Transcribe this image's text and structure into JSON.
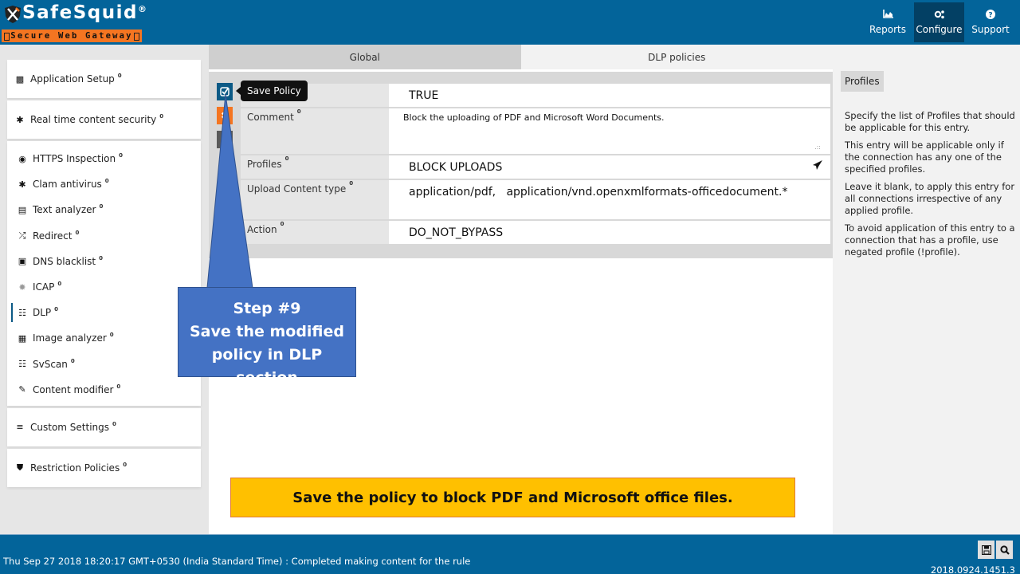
{
  "header": {
    "logo_title": "SafeSquid",
    "logo_reg": "®",
    "logo_subtitle": "Secure Web Gateway",
    "nav": [
      {
        "label": "Reports",
        "icon": "area-chart-icon",
        "active": false
      },
      {
        "label": "Configure",
        "icon": "cogs-icon",
        "active": true
      },
      {
        "label": "Support",
        "icon": "question-circle-icon",
        "active": false
      }
    ]
  },
  "sidebar": {
    "info_glyph": "0",
    "sections": [
      {
        "label": "Application Setup",
        "icon": "briefcase-icon"
      },
      {
        "label": "Real time content security",
        "icon": "bug-icon"
      }
    ],
    "items": [
      {
        "label": "HTTPS Inspection",
        "icon": "eye-icon"
      },
      {
        "label": "Clam antivirus",
        "icon": "asterisk-icon"
      },
      {
        "label": "Text analyzer",
        "icon": "file-text-icon"
      },
      {
        "label": "Redirect",
        "icon": "random-icon"
      },
      {
        "label": "DNS blacklist",
        "icon": "dns-icon"
      },
      {
        "label": "ICAP",
        "icon": "icap-icon"
      },
      {
        "label": "DLP",
        "icon": "barcode-icon",
        "active": true
      },
      {
        "label": "Image analyzer",
        "icon": "image-file-icon"
      },
      {
        "label": "SvScan",
        "icon": "barcode-icon"
      },
      {
        "label": "Content modifier",
        "icon": "edit-icon"
      }
    ],
    "bottom_sections": [
      {
        "label": "Custom Settings",
        "icon": "sliders-icon"
      },
      {
        "label": "Restriction Policies",
        "icon": "shield-icon"
      }
    ]
  },
  "main": {
    "tabs": [
      {
        "label": "Global",
        "active": false
      },
      {
        "label": "DLP policies",
        "active": true
      }
    ],
    "tooltip": "Save Policy",
    "policy": {
      "enabled": "TRUE",
      "comment_label": "Comment",
      "comment": "Block the uploading of PDF and Microsoft Word Documents.",
      "profiles_label": "Profiles",
      "profiles": "BLOCK UPLOADS",
      "upload_label": "Upload Content type",
      "upload": "application/pdf,   application/vnd.openxmlformats-officedocument.*",
      "action_label": "Action",
      "action": "DO_NOT_BYPASS"
    }
  },
  "help": {
    "tag": "Profiles",
    "paragraphs": [
      "Specify the list of Profiles that should be applicable for this entry.",
      "This entry will be applicable only if the connection has any one of the specified profiles.",
      "Leave it blank, to apply this entry for all connections irrespective of any applied profile.",
      "To avoid application of this entry to a connection that has a profile, use negated profile (!profile)."
    ]
  },
  "annotation": {
    "step": "Step #9",
    "line1": "Save the modified",
    "line2": "policy in DLP section",
    "banner": "Save the policy to block PDF and Microsoft office files."
  },
  "footer": {
    "status": "Thu Sep 27 2018 18:20:17 GMT+0530 (India Standard Time) : Completed making content for the rule",
    "version": "2018.0924.1451.3"
  },
  "colors": {
    "brand_blue": "#03649a",
    "brand_orange": "#f47521",
    "callout_blue": "#4472c4",
    "banner_yellow": "#ffc000"
  }
}
